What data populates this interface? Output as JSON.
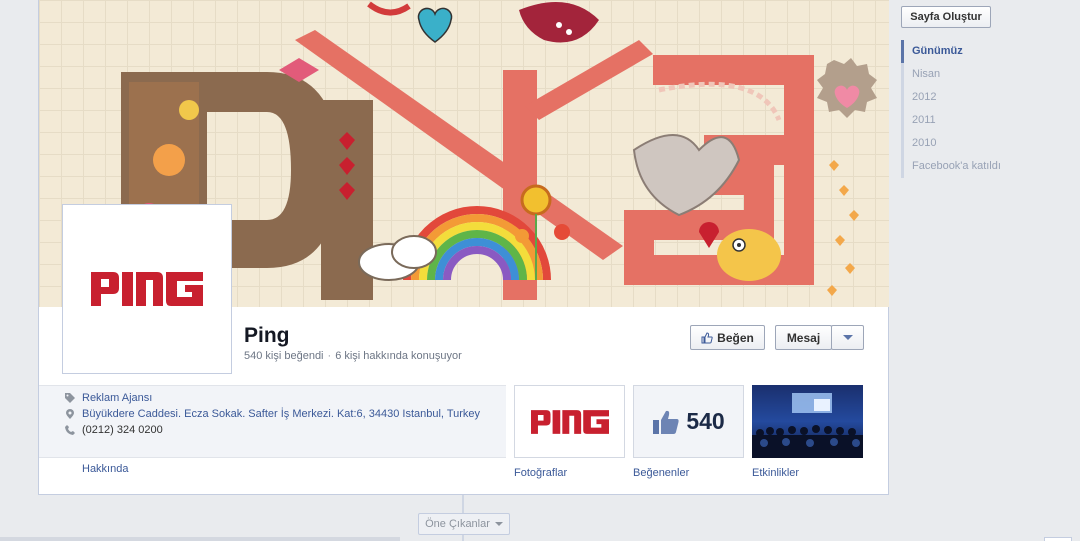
{
  "page": {
    "name": "Ping",
    "likes_text": "540 kişi beğendi",
    "talking_text": "6 kişi hakkında konuşuyor",
    "logo_text": "PING"
  },
  "actions": {
    "like_label": "Beğen",
    "message_label": "Mesaj"
  },
  "about": {
    "category": "Reklam Ajansı",
    "address": "Büyükdere Caddesi. Ecza Sokak. Safter İş Merkezi. Kat:6, 34430 Istanbul, Turkey",
    "phone": "(0212) 324 0200",
    "link_label": "Hakkında"
  },
  "apps": [
    {
      "label": "Fotoğraflar"
    },
    {
      "label": "Beğenenler",
      "count": "540"
    },
    {
      "label": "Etkinlikler"
    }
  ],
  "highlights_label": "Öne Çıkanlar",
  "sidebar": {
    "create_page_label": "Sayfa Oluştur",
    "scrubber": [
      "Günümüz",
      "Nisan",
      "2012",
      "2011",
      "2010",
      "Facebook'a katıldı"
    ]
  },
  "colors": {
    "brand_red": "#c8202f",
    "link_blue": "#3b5998",
    "cover_bg": "#f3ead6"
  }
}
